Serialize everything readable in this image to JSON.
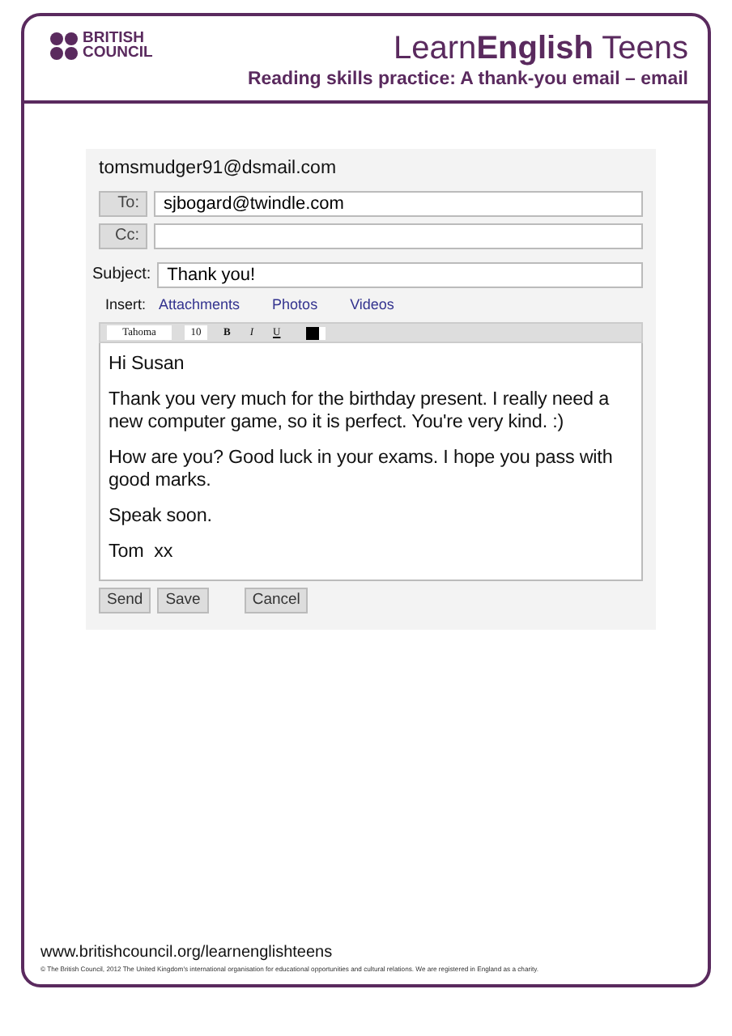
{
  "header": {
    "logo_lines": [
      "BRITISH",
      "COUNCIL"
    ],
    "brand": "Learn**English** Teens",
    "subtitle": "Reading skills practice: A thank-you email – email"
  },
  "email": {
    "from": "tomsmudger91@dsmail.com",
    "fields": [
      {
        "label": "To:",
        "value": "sjbogard@twindle.com"
      },
      {
        "label": "Cc:"
      }
    ],
    "subject": {
      "label": "Subject:",
      "value": "Thank you!"
    },
    "insert": {
      "label": "Insert:",
      "links": [
        "Attachments",
        "Photos",
        "Videos"
      ]
    },
    "toolbar": {
      "font": "Tahoma",
      "size": "10",
      "buttons": [
        {
          "label": "B",
          "kind": "bold"
        },
        {
          "label": "I",
          "kind": "italic"
        },
        {
          "label": "U",
          "kind": "underline"
        }
      ]
    },
    "body": [
      "Hi Susan",
      "Thank you very much for the birthday present. I really need a new computer game, so it is perfect. You're very kind. :)",
      "How are you? Good luck in your exams. I hope you pass with good marks.",
      "Speak soon.",
      "Tom  xx"
    ],
    "buttons": [
      "Send",
      "Save",
      "Cancel"
    ]
  },
  "footer": {
    "url": "www.britishcouncil.org/learnenglishteens",
    "copyright": "© The British Council, 2012 The United Kingdom's international organisation for educational opportunities and cultural relations. We are registered in England as a charity."
  }
}
